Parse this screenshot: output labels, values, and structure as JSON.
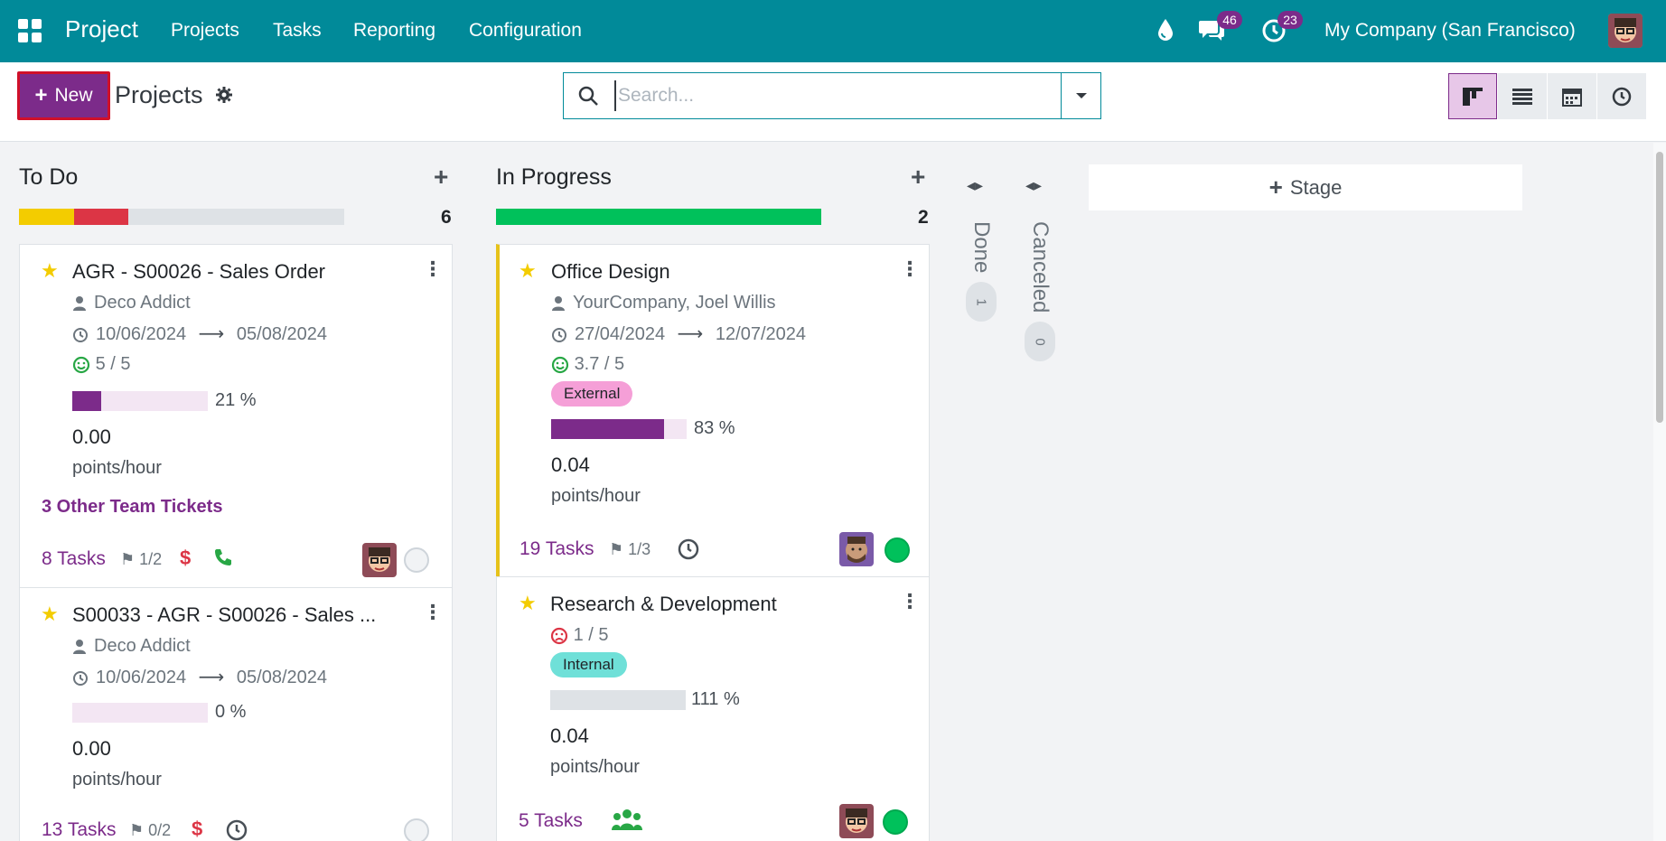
{
  "navbar": {
    "brand": "Project",
    "menu": [
      "Projects",
      "Tasks",
      "Reporting",
      "Configuration"
    ],
    "messages_badge": "46",
    "activities_badge": "23",
    "company": "My Company (San Francisco)"
  },
  "control_panel": {
    "new_label": "New",
    "title": "Projects",
    "search_placeholder": "Search..."
  },
  "columns": [
    {
      "title": "To Do",
      "count": "6",
      "progress": [
        {
          "color": "#f3cc00",
          "fraction": 0.17
        },
        {
          "color": "#dc3545",
          "fraction": 0.17
        },
        {
          "color": "#dee2e6",
          "fraction": 0.66
        }
      ],
      "cards": [
        {
          "title": "AGR - S00026 - Sales Order",
          "customer": "Deco Addict",
          "date_start": "10/06/2024",
          "date_end": "05/08/2024",
          "rating": "5 / 5",
          "progress": 0.21,
          "progress_label": "21 %",
          "metric": "0.00",
          "unit": "points/hour",
          "extra_link": "3 Other Team Tickets",
          "tasks": "8 Tasks",
          "milestones": "1/2"
        },
        {
          "title": "S00033 - AGR - S00026 - Sales ...",
          "customer": "Deco Addict",
          "date_start": "10/06/2024",
          "date_end": "05/08/2024",
          "progress": 0.0,
          "progress_label": "0 %",
          "metric": "0.00",
          "unit": "points/hour",
          "tasks": "13 Tasks",
          "milestones": "0/2"
        }
      ]
    },
    {
      "title": "In Progress",
      "count": "2",
      "progress": [
        {
          "color": "#00c15b",
          "fraction": 1.0
        }
      ],
      "cards": [
        {
          "title": "Office Design",
          "customer": "YourCompany, Joel Willis",
          "date_start": "27/04/2024",
          "date_end": "12/07/2024",
          "rating": "3.7 / 5",
          "tag": "External",
          "progress": 0.83,
          "progress_label": "83 %",
          "metric": "0.04",
          "unit": "points/hour",
          "tasks": "19 Tasks",
          "milestones": "1/3"
        },
        {
          "title": "Research & Development",
          "rating": "1 / 5",
          "tag": "Internal",
          "progress": 1.11,
          "progress_label": "111 %",
          "metric": "0.04",
          "unit": "points/hour",
          "tasks": "5 Tasks"
        }
      ]
    }
  ],
  "folded_columns": [
    {
      "title": "Done",
      "count": "1"
    },
    {
      "title": "Canceled",
      "count": "0"
    }
  ],
  "add_stage_label": "Stage",
  "colors": {
    "navbar": "#018a99",
    "primary": "#7c2b8a",
    "status_green": "#00c15b",
    "star": "#f3cc00"
  }
}
